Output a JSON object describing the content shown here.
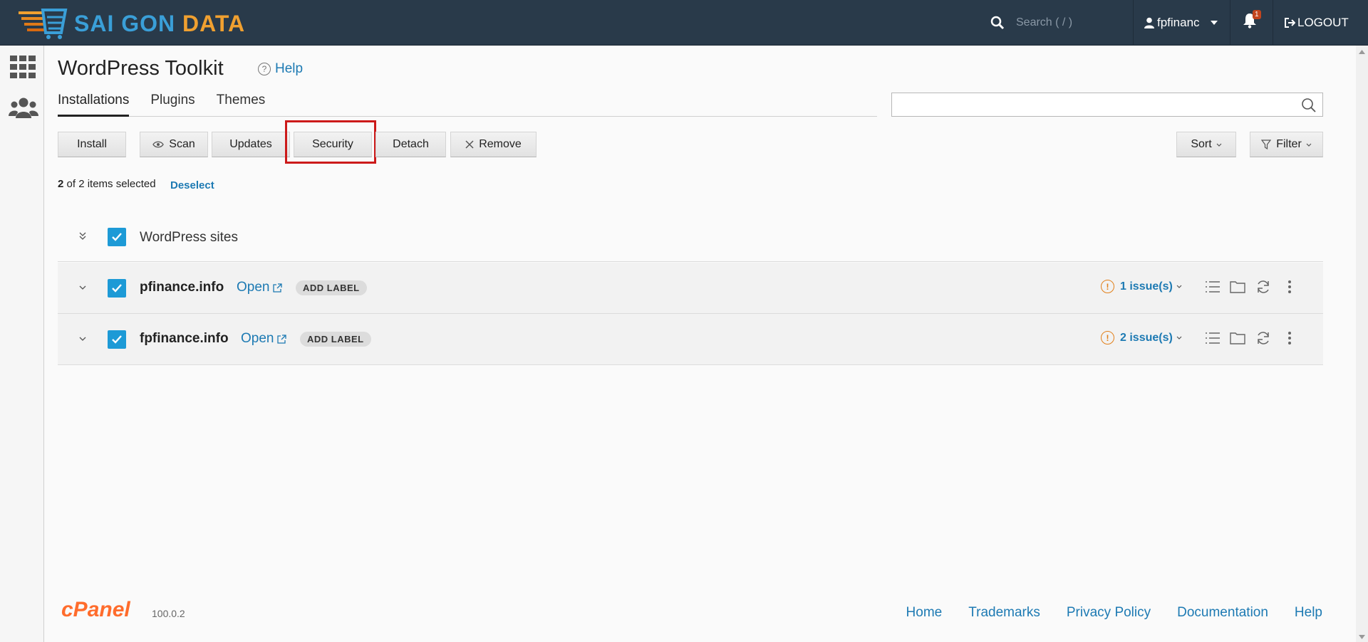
{
  "header": {
    "logo": {
      "part1": "SAI GON",
      "part2": "DATA"
    },
    "search_placeholder": "Search ( / )",
    "user": "fpfinanc",
    "notifications_count": "1",
    "logout": "LOGOUT"
  },
  "page": {
    "title": "WordPress Toolkit",
    "help": "Help"
  },
  "tabs": [
    {
      "label": "Installations",
      "active": true
    },
    {
      "label": "Plugins",
      "active": false
    },
    {
      "label": "Themes",
      "active": false
    }
  ],
  "toolbar": {
    "install": "Install",
    "scan": "Scan",
    "updates": "Updates",
    "security": "Security",
    "detach": "Detach",
    "remove": "Remove",
    "sort": "Sort",
    "filter": "Filter"
  },
  "selection": {
    "count": "2",
    "suffix": "of 2 items selected",
    "deselect": "Deselect"
  },
  "group": {
    "label": "WordPress sites"
  },
  "sites": [
    {
      "name": "pfinance.info",
      "open": "Open",
      "label": "ADD LABEL",
      "issues": "1 issue(s)"
    },
    {
      "name": "fpfinance.info",
      "open": "Open",
      "label": "ADD LABEL",
      "issues": "2 issue(s)"
    }
  ],
  "footer": {
    "logo": "cPanel",
    "version": "100.0.2",
    "links": [
      "Home",
      "Trademarks",
      "Privacy Policy",
      "Documentation",
      "Help"
    ]
  }
}
